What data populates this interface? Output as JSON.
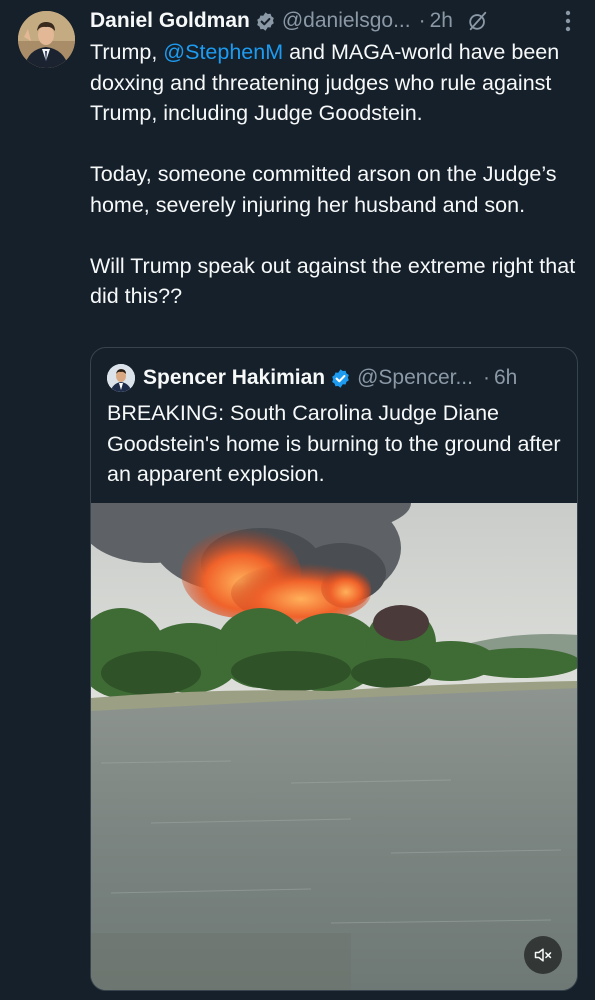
{
  "tweet": {
    "author_name": "Daniel Goldman",
    "author_handle": "@danielsgo...",
    "separator": "·",
    "time": "2h",
    "text_segments": {
      "p1_before": "Trump, ",
      "p1_mention": "@StephenM",
      "p1_after": " and MAGA-world have been doxxing and threatening judges who rule against Trump, including Judge Goodstein.",
      "p2": "Today, someone committed arson on the Judge’s home, severely injuring her husband and son.",
      "p3": "Will Trump speak out against the extreme right that did this??"
    }
  },
  "quote": {
    "author_name": "Spencer Hakimian",
    "author_handle": "@Spencer...",
    "separator": "·",
    "time": "6h",
    "text": "BREAKING: South Carolina Judge Diane Goodstein's home is burning to the ground after an apparent explosion."
  },
  "icons": {
    "verified": "verified-badge-icon",
    "grok": "grok-icon",
    "more": "more-options-icon",
    "mute": "volume-muted-icon"
  },
  "colors": {
    "background": "#15202b",
    "text": "#f7f9f9",
    "secondary_text": "#8b98a5",
    "accent": "#1d9bf0",
    "border": "#38444d"
  }
}
